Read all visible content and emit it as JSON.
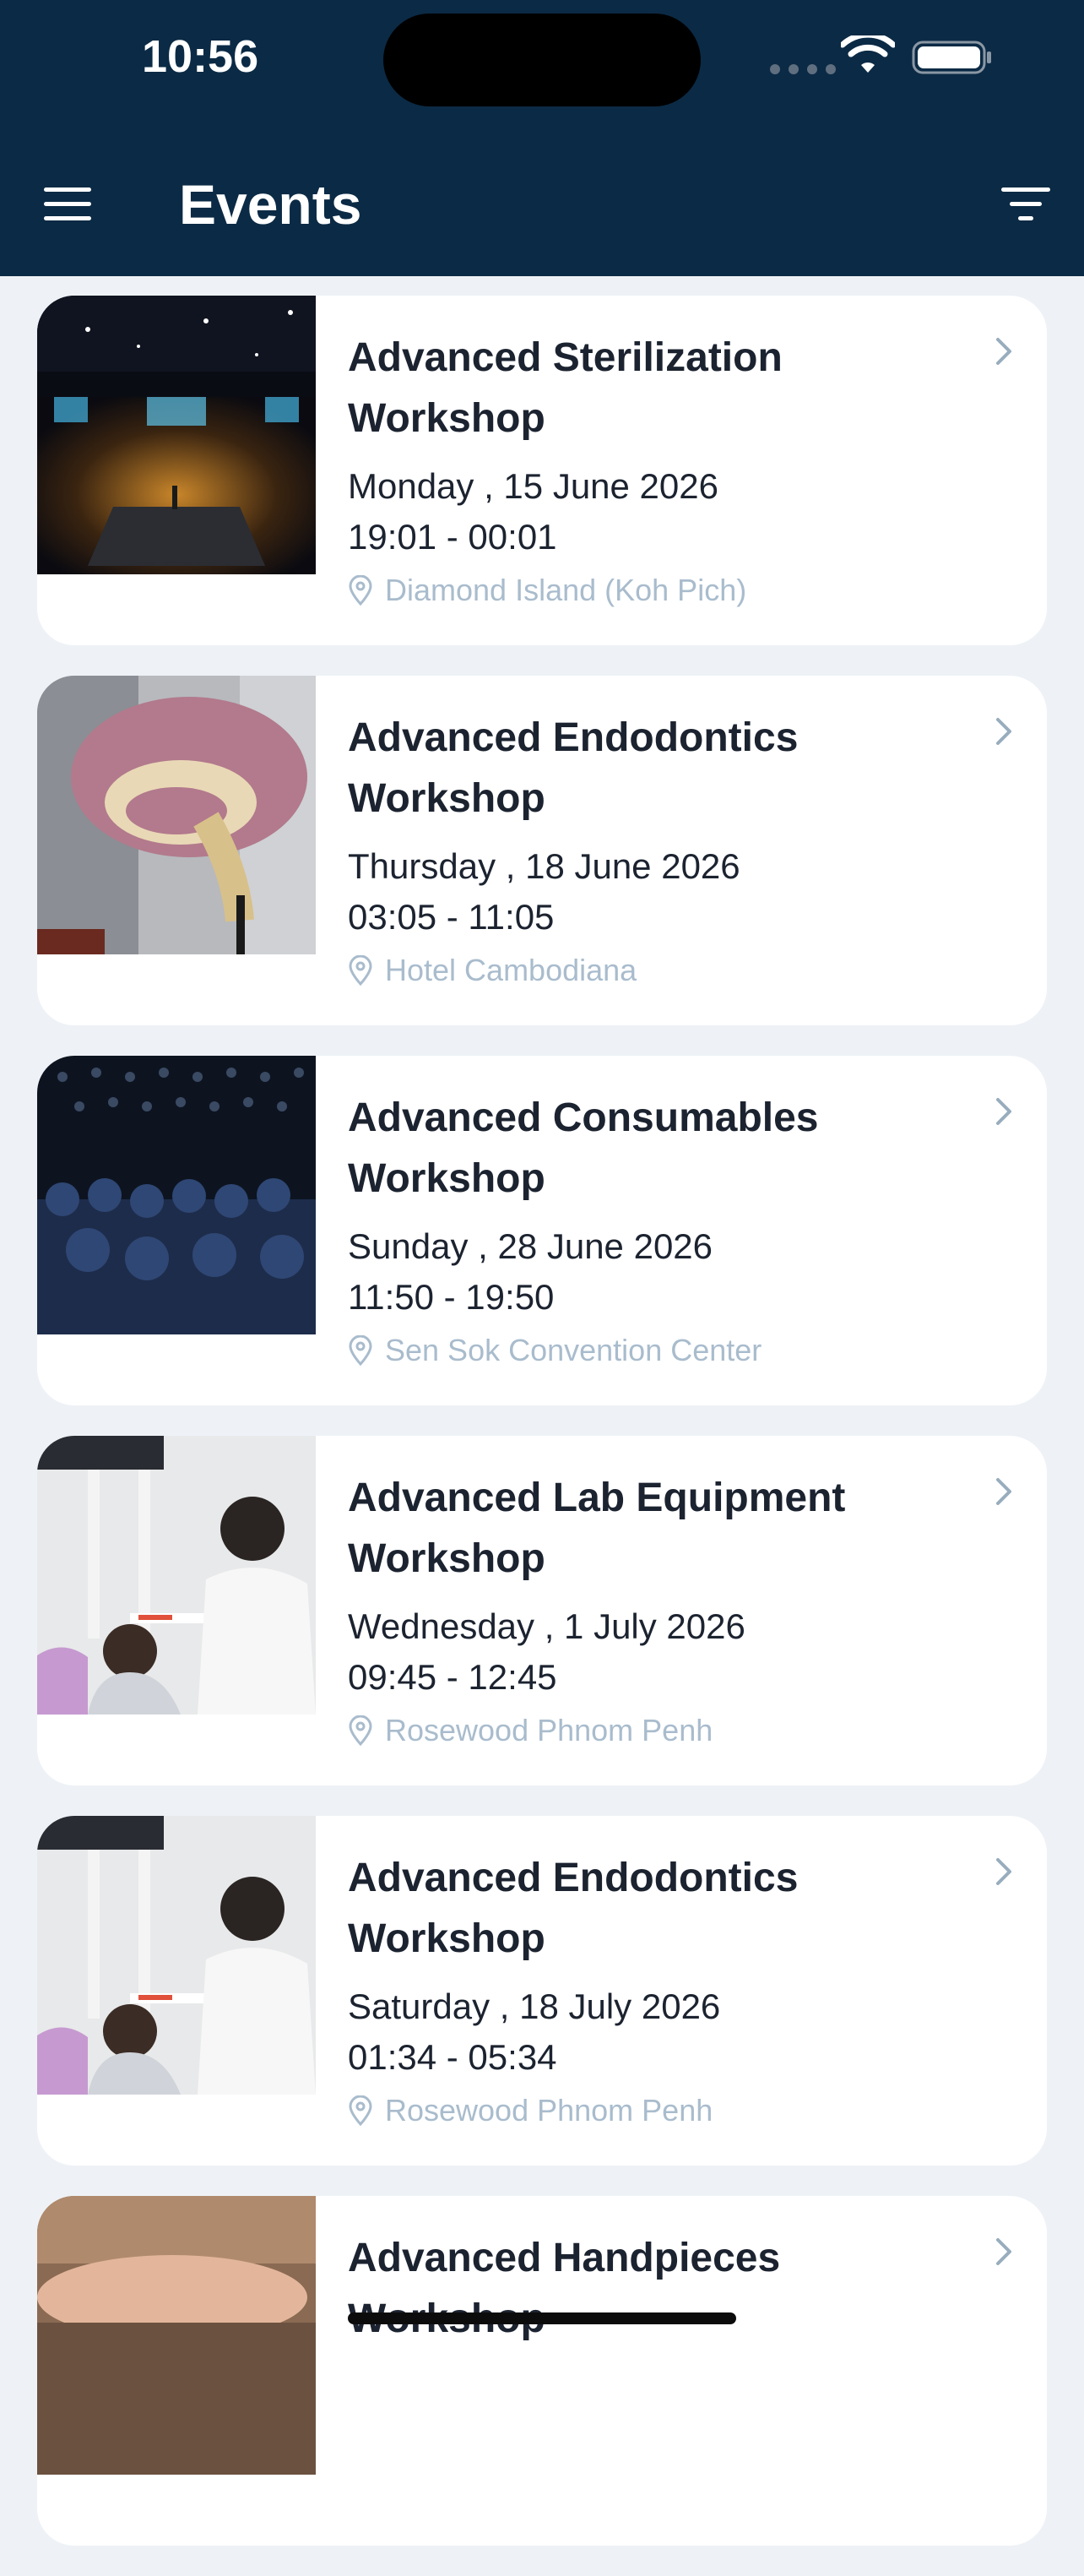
{
  "status_bar": {
    "time": "10:56"
  },
  "header": {
    "title": "Events"
  },
  "icons": {
    "menu": "menu-icon",
    "filter": "filter-icon",
    "chevron": "chevron-right-icon",
    "pin": "location-pin-icon"
  },
  "colors": {
    "header_bg": "#0b2a45",
    "page_bg": "#eef2f6",
    "card_bg": "#ffffff",
    "title_text": "#1c2330",
    "location_text": "#a9bccd"
  },
  "events": [
    {
      "title_line1": "Advanced Sterilization",
      "title_line2": "Workshop",
      "date": "Monday , 15 June 2026",
      "time": "19:01 - 00:01",
      "location": "Diamond Island (Koh Pich)"
    },
    {
      "title_line1": "Advanced Endodontics",
      "title_line2": "Workshop",
      "date": "Thursday , 18 June 2026",
      "time": "03:05 - 11:05",
      "location": "Hotel Cambodiana"
    },
    {
      "title_line1": "Advanced Consumables",
      "title_line2": "Workshop",
      "date": "Sunday , 28 June 2026",
      "time": "11:50 - 19:50",
      "location": "Sen Sok Convention Center"
    },
    {
      "title_line1": "Advanced Lab Equipment",
      "title_line2": "Workshop",
      "date": "Wednesday , 1 July 2026",
      "time": "09:45 - 12:45",
      "location": "Rosewood Phnom Penh"
    },
    {
      "title_line1": "Advanced Endodontics",
      "title_line2": "Workshop",
      "date": "Saturday , 18 July 2026",
      "time": "01:34 - 05:34",
      "location": "Rosewood Phnom Penh"
    },
    {
      "title_line1": "Advanced Handpieces",
      "title_line2": "Workshop",
      "date": "",
      "time": "",
      "location": ""
    }
  ]
}
